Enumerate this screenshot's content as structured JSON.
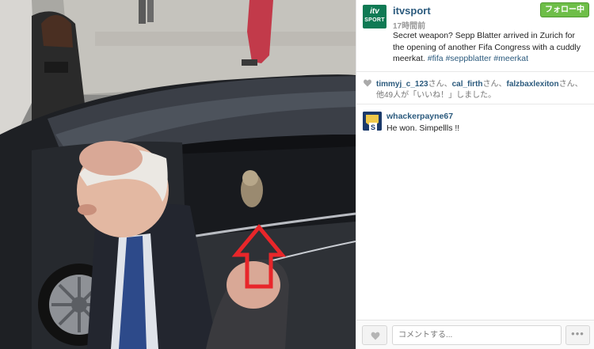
{
  "post": {
    "username": "itvsport",
    "time": "17時間前",
    "follow_label": "フォロー中",
    "avatar_logo_top": "itv",
    "avatar_logo_bottom": "SPORT",
    "caption_text": "Secret weapon? Sepp Blatter arrived in Zurich for the opening of another Fifa Congress with a cuddly meerkat.",
    "hashtags": [
      "#fifa",
      "#seppblatter",
      "#meerkat"
    ]
  },
  "likes": {
    "user1": "timmyj_c_123",
    "user2": "cal_firth",
    "user3": "falzbaxlexiton",
    "suffix_san": "さん、",
    "suffix_san_end": "さん、",
    "others": "他49人が「いいね！」しました。"
  },
  "comments": [
    {
      "username": "whackerpayne67",
      "text": "He won. Simpellls !!"
    }
  ],
  "footer": {
    "comment_placeholder": "コメントする...",
    "more_label": "•••"
  },
  "colors": {
    "brand_green": "#0f7a54",
    "follow_green": "#6ebe48",
    "link_blue": "#2b5a7d",
    "arrow_red": "#e8262a"
  },
  "icons": {
    "like": "heart-icon",
    "more": "ellipsis-icon"
  }
}
